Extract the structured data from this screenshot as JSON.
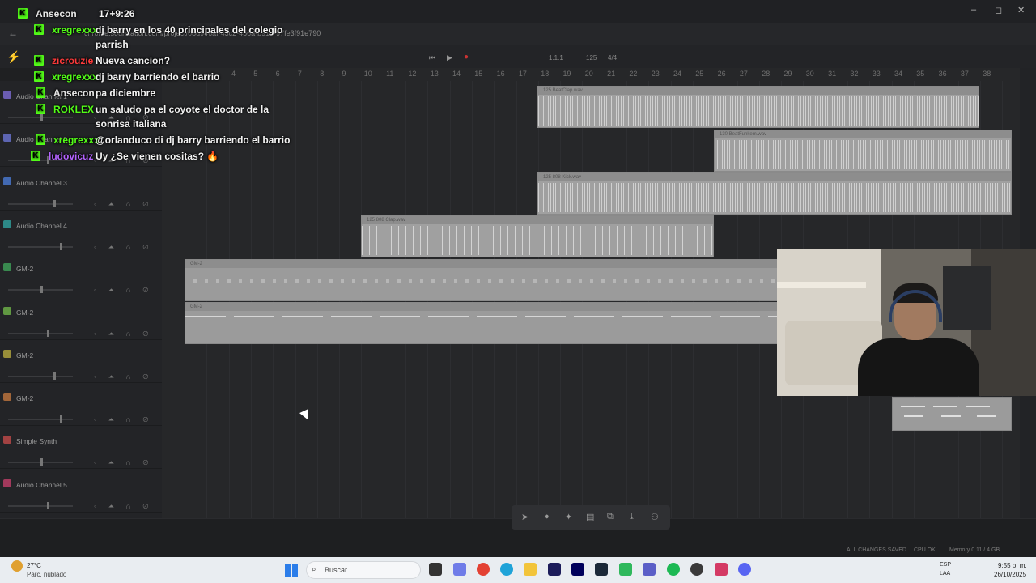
{
  "browser": {
    "url": "chrome.soundation.com/project/08d946af-43c2-456a-b916-97fe3f91e790",
    "window_controls": [
      "–",
      "◻",
      "✕"
    ]
  },
  "chat": {
    "messages": [
      {
        "user": "Ansecon",
        "text": "17+9:26",
        "user_color": "#e6e6e6"
      },
      {
        "user": "xregrexxx",
        "text": "dj barry en los 40 principales del colegio parrish",
        "user_color": "#53fc18"
      },
      {
        "user": "zicrouzie",
        "text": "Nueva cancion?",
        "user_color": "#ff3b3b"
      },
      {
        "user": "xregrexxx",
        "text": "dj barry barriendo el barrio",
        "user_color": "#53fc18"
      },
      {
        "user": "Ansecon",
        "text": "pa diciembre",
        "user_color": "#e6e6e6"
      },
      {
        "user": "ROKLEX",
        "text": "un saludo pa el coyote el doctor de la sonrisa italiana",
        "user_color": "#53fc18"
      },
      {
        "user": "xregrexxx",
        "text": "@orlanduco di dj barry barriendo el barrio",
        "user_color": "#53fc18"
      },
      {
        "user": "ludovicuz",
        "text": "Uy ¿Se vienen cositas? 🔥",
        "user_color": "#b463ff"
      }
    ]
  },
  "transport": {
    "position": "1.1.1",
    "bpm": "125",
    "time_signature": "4/4"
  },
  "ruler": {
    "bars": [
      "4",
      "5",
      "6",
      "7",
      "8",
      "9",
      "10",
      "11",
      "12",
      "13",
      "14",
      "15",
      "16",
      "17",
      "18",
      "19",
      "20",
      "21",
      "22",
      "23",
      "24",
      "25",
      "26",
      "27",
      "28",
      "29",
      "30",
      "31",
      "32",
      "33",
      "34",
      "35",
      "36",
      "37",
      "38"
    ]
  },
  "tracks": [
    {
      "name": "Audio Channel 1",
      "color": "#7d6bd6"
    },
    {
      "name": "Audio Channel 2",
      "color": "#6b75d6"
    },
    {
      "name": "Audio Channel 3",
      "color": "#4a7bd6"
    },
    {
      "name": "Audio Channel 4",
      "color": "#2fa3a0"
    },
    {
      "name": "GM-2",
      "color": "#3fa35a"
    },
    {
      "name": "GM-2",
      "color": "#6fb54a"
    },
    {
      "name": "GM-2",
      "color": "#b5a93f"
    },
    {
      "name": "GM-2",
      "color": "#c2773f"
    },
    {
      "name": "Simple Synth",
      "color": "#c24a4a"
    },
    {
      "name": "Audio Channel 5",
      "color": "#c23f6a"
    }
  ],
  "clips": [
    {
      "label": "125 BeatClap.wav"
    },
    {
      "label": "130 BeatFunkem.wav"
    },
    {
      "label": "125 808 Kick.wav"
    },
    {
      "label": "125 808 Clap.wav"
    },
    {
      "label": "GM-2"
    },
    {
      "label": "GM-2"
    }
  ],
  "status": {
    "saved": "ALL CHANGES SAVED",
    "cpu": "CPU OK",
    "memory": "Memory 0.11 / 4 GB"
  },
  "taskbar": {
    "temperature": "27°C",
    "weather": "Parc. nublado",
    "search_placeholder": "Buscar",
    "lang_top": "ESP",
    "lang_bottom": "LAA",
    "time": "9:55 p. m.",
    "date": "26/10/2025"
  }
}
